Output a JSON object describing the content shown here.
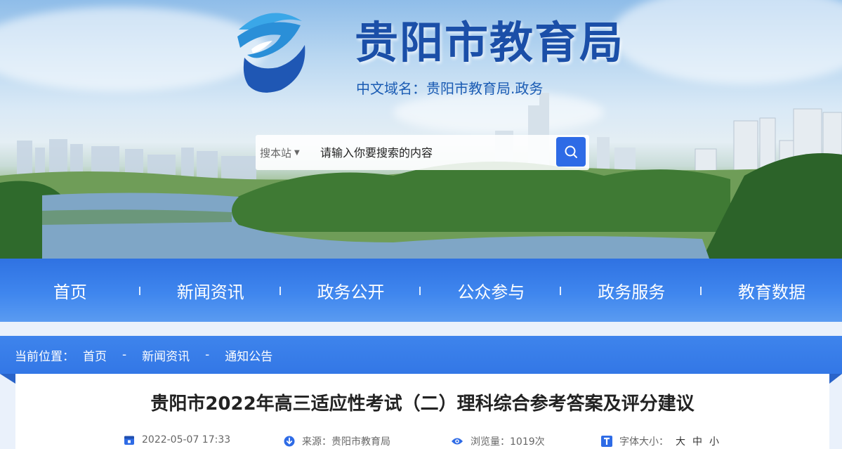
{
  "header": {
    "site_title": "贵阳市教育局",
    "domain_line": "中文域名：贵阳市教育局.政务",
    "logo_icon": "e-logo-icon"
  },
  "search": {
    "scope_label": "搜本站",
    "placeholder": "请输入你要搜索的内容",
    "button_icon": "search-icon"
  },
  "nav": {
    "items": [
      "首页",
      "新闻资讯",
      "政务公开",
      "公众参与",
      "政务服务",
      "教育数据"
    ]
  },
  "breadcrumb": {
    "label": "当前位置：",
    "items": [
      "首页",
      "新闻资讯",
      "通知公告"
    ],
    "separator": "-"
  },
  "article": {
    "title": "贵阳市2022年高三适应性考试（二）理科综合参考答案及评分建议",
    "date": "2022-05-07 17:33",
    "source": "来源：贵阳市教育局",
    "views": "浏览量：1019次",
    "font_size_label": "字体大小：",
    "font_sizes": [
      "大",
      "中",
      "小"
    ]
  },
  "colors": {
    "primary": "#2e6be6",
    "nav_bg": "#3f86ee",
    "title_blue": "#1b4fa8"
  }
}
